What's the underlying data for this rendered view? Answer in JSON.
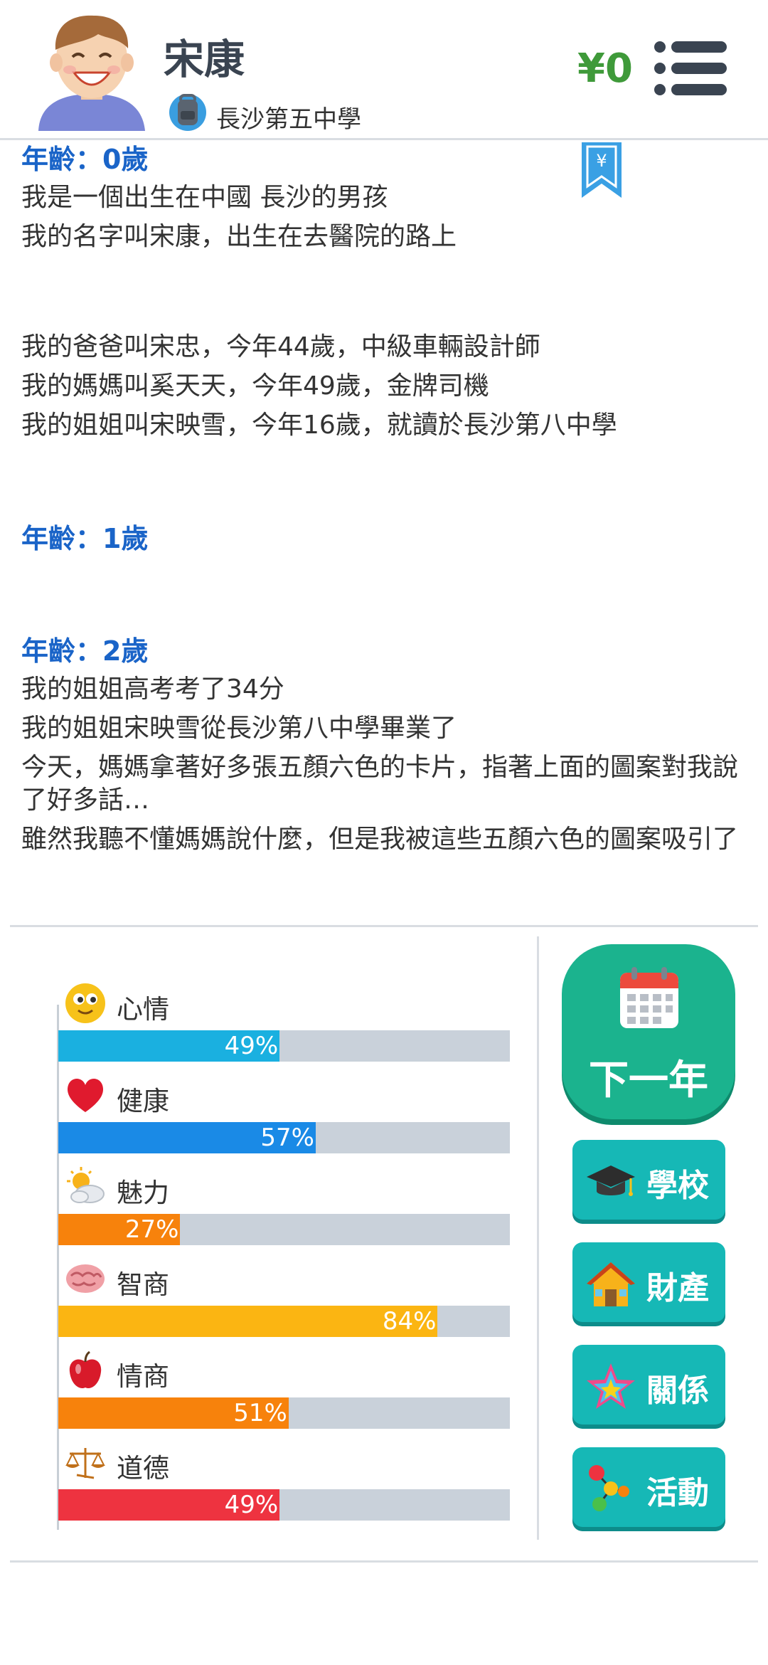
{
  "header": {
    "name": "宋康",
    "school": "長沙第五中學",
    "money": "¥0"
  },
  "bookmark": {
    "symbol": "¥"
  },
  "log": [
    {
      "age": "年齡：0歲",
      "lines": [
        "我是一個出生在中國 長沙的男孩",
        "我的名字叫宋康，出生在去醫院的路上",
        "",
        "我的爸爸叫宋忠，今年44歲，中級車輛設計師",
        "我的媽媽叫奚天天，今年49歲，金牌司機",
        "我的姐姐叫宋映雪，今年16歲，就讀於長沙第八中學"
      ]
    },
    {
      "age": "年齡：1歲",
      "lines": []
    },
    {
      "age": "年齡：2歲",
      "lines": [
        "我的姐姐高考考了34分",
        "我的姐姐宋映雪從長沙第八中學畢業了",
        "今天，媽媽拿著好多張五顏六色的卡片，指著上面的圖案對我說了好多話…",
        "雖然我聽不懂媽媽說什麼，但是我被這些五顏六色的圖案吸引了"
      ]
    }
  ],
  "stats": [
    {
      "label": "心情",
      "value": 49,
      "text": "49%",
      "color": "#1ab0e0",
      "icon": "smiley-icon"
    },
    {
      "label": "健康",
      "value": 57,
      "text": "57%",
      "color": "#1a8ae6",
      "icon": "heart-icon"
    },
    {
      "label": "魅力",
      "value": 27,
      "text": "27%",
      "color": "#f7820c",
      "icon": "sun-cloud-icon"
    },
    {
      "label": "智商",
      "value": 84,
      "text": "84%",
      "color": "#fbb512",
      "icon": "brain-icon"
    },
    {
      "label": "情商",
      "value": 51,
      "text": "51%",
      "color": "#f7820c",
      "icon": "apple-icon"
    },
    {
      "label": "道德",
      "value": 49,
      "text": "49%",
      "color": "#ee3340",
      "icon": "scales-icon"
    }
  ],
  "actions": {
    "next_year": "下一年",
    "school": "學校",
    "property": "財產",
    "relations": "關係",
    "activities": "活動"
  }
}
